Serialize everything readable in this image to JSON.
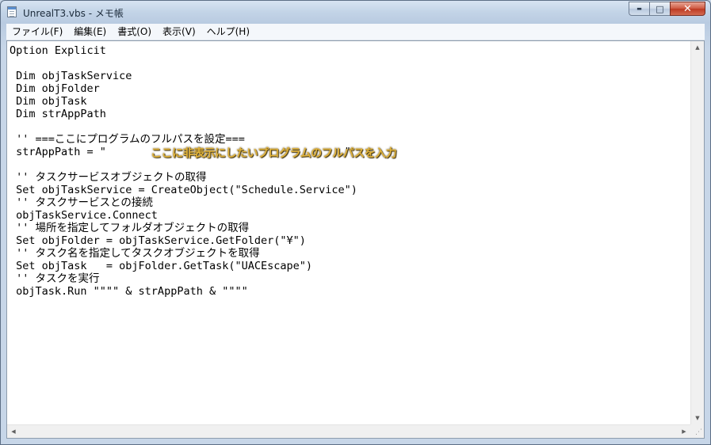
{
  "window": {
    "title": "UnrealT3.vbs - メモ帳",
    "buttons": {
      "minimize": "▬",
      "maximize": "□",
      "close": "✕"
    }
  },
  "menu": {
    "items": [
      "ファイル(F)",
      "編集(E)",
      "書式(O)",
      "表示(V)",
      "ヘルプ(H)"
    ]
  },
  "editor": {
    "lines": [
      "Option Explicit",
      "",
      " Dim objTaskService",
      " Dim objFolder",
      " Dim objTask",
      " Dim strAppPath",
      "",
      " '' ===ここにプログラムのフルパスを設定===",
      " strAppPath = \"                                     \"",
      "",
      " '' タスクサービスオブジェクトの取得",
      " Set objTaskService = CreateObject(\"Schedule.Service\")",
      " '' タスクサービスとの接続",
      " objTaskService.Connect",
      " '' 場所を指定してフォルダオブジェクトの取得",
      " Set objFolder = objTaskService.GetFolder(\"¥\")",
      " '' タスク名を指定してタスクオブジェクトを取得",
      " Set objTask   = objFolder.GetTask(\"UACEscape\")",
      " '' タスクを実行",
      " objTask.Run \"\"\"\" & strAppPath & \"\"\"\""
    ],
    "annotation": "ここに非表示にしたいプログラムのフルパスを入力"
  },
  "scrollbars": {
    "up_icon": "up-arrow-icon",
    "down_icon": "down-arrow-icon",
    "left_icon": "left-arrow-icon",
    "right_icon": "right-arrow-icon"
  }
}
